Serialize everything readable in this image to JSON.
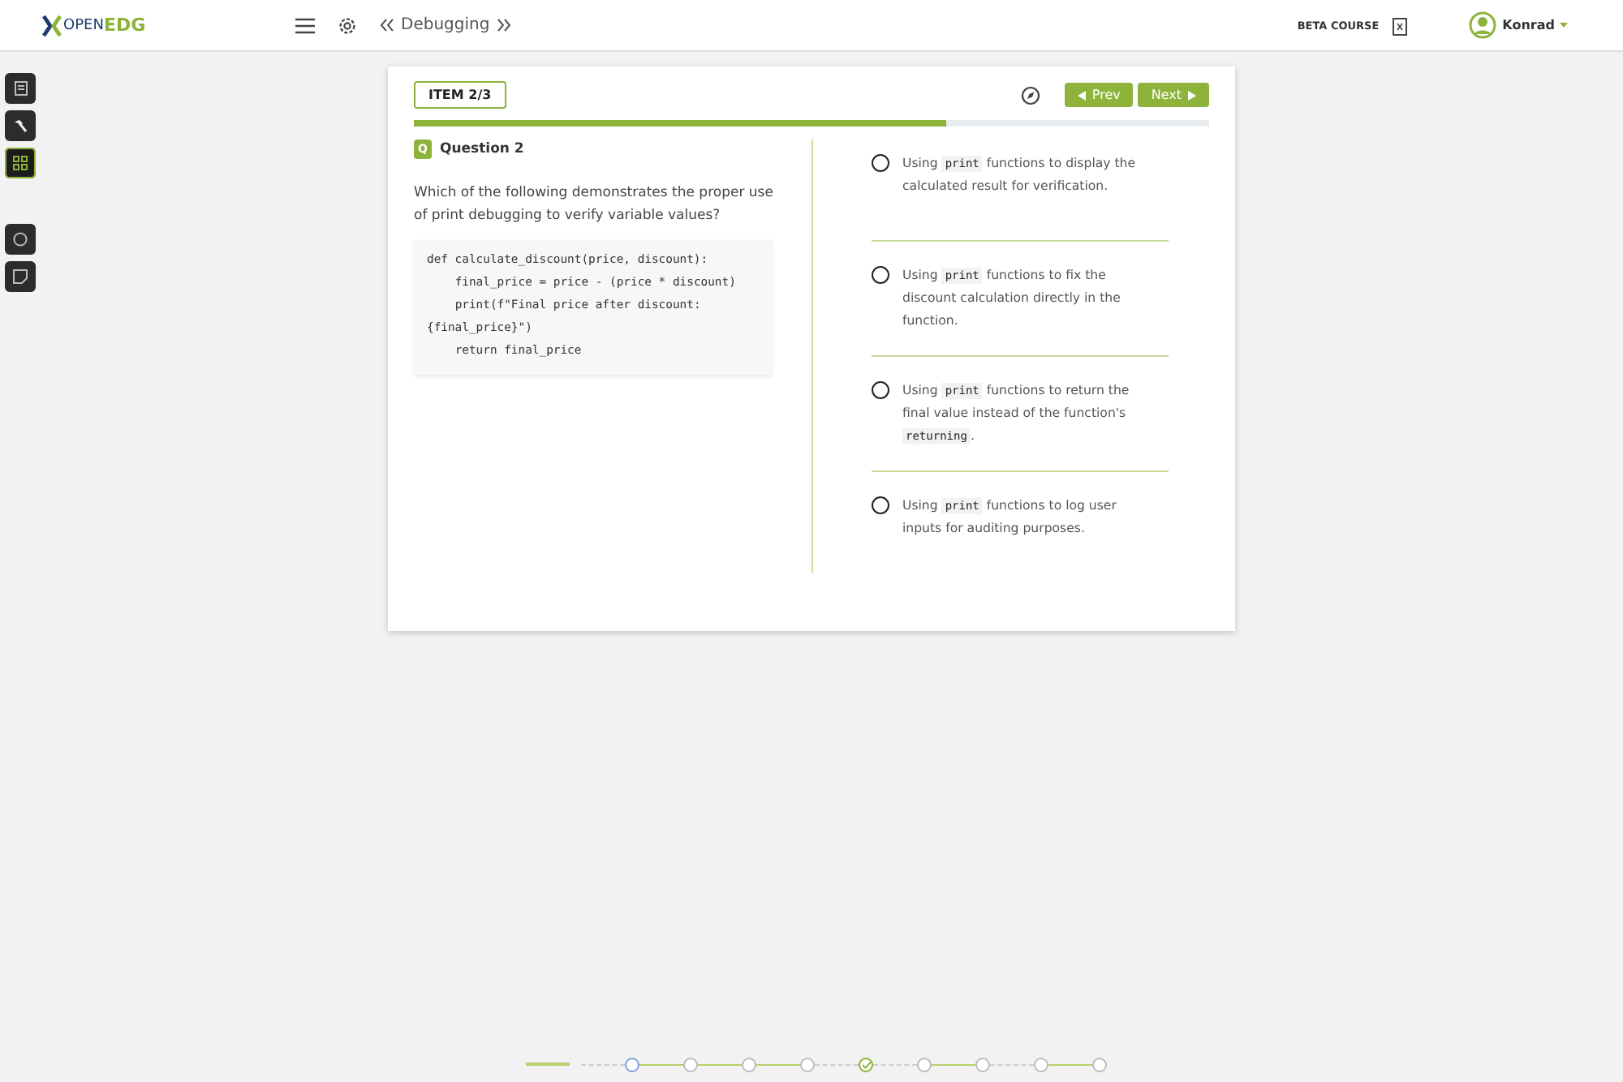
{
  "header": {
    "logo_prefix": "OPEN",
    "logo_suffix": "EDG",
    "breadcrumb": "Debugging",
    "course_label": "BETA COURSE",
    "user": "Konrad"
  },
  "sidebar_tools": [
    {
      "kind": "page",
      "selected": false
    },
    {
      "kind": "hammer",
      "selected": false
    },
    {
      "kind": "grid",
      "selected": true
    },
    {
      "kind": "chat",
      "selected": false
    },
    {
      "kind": "note",
      "selected": false
    }
  ],
  "item": {
    "label": "ITEM 2/3",
    "prev": "Prev",
    "next": "Next",
    "level": 0.67
  },
  "question": {
    "badge": "Q",
    "title": "Question 2",
    "prompt": "Which of the following demonstrates the proper use of print debugging to verify variable values?",
    "code": "def calculate_discount(price, discount):\n    final_price = price - (price * discount)\n    print(f\"Final price after discount: {final_price}\")\n    return final_price"
  },
  "options": [
    {
      "selected": false,
      "parts": [
        {
          "kind": "text",
          "text": "Using "
        },
        {
          "kind": "code",
          "text": "print"
        },
        {
          "kind": "text",
          "text": " functions to display the calculated result for verification."
        }
      ]
    },
    {
      "selected": false,
      "parts": [
        {
          "kind": "text",
          "text": "Using "
        },
        {
          "kind": "code",
          "text": "print"
        },
        {
          "kind": "text",
          "text": " functions to fix the discount calculation directly in the function."
        }
      ]
    },
    {
      "selected": false,
      "parts": [
        {
          "kind": "text",
          "text": "Using "
        },
        {
          "kind": "code",
          "text": "print"
        },
        {
          "kind": "text",
          "text": " functions to return the final value instead of the function's "
        },
        {
          "kind": "code",
          "text": "returning"
        },
        {
          "kind": "text",
          "text": "."
        }
      ]
    },
    {
      "selected": false,
      "parts": [
        {
          "kind": "text",
          "text": "Using "
        },
        {
          "kind": "code",
          "text": "print"
        },
        {
          "kind": "text",
          "text": " functions to log user inputs for auditing purposes."
        }
      ]
    }
  ],
  "stepper": [
    {
      "dashed": true,
      "current": true,
      "done": false
    },
    {
      "dashed": false,
      "current": false,
      "done": false
    },
    {
      "dashed": false,
      "current": false,
      "done": false
    },
    {
      "dashed": false,
      "current": false,
      "done": false
    },
    {
      "dashed": true,
      "current": false,
      "done": true
    },
    {
      "dashed": true,
      "current": false,
      "done": false
    },
    {
      "dashed": false,
      "current": false,
      "done": false
    },
    {
      "dashed": true,
      "current": false,
      "done": false
    },
    {
      "dashed": false,
      "current": false,
      "done": false
    }
  ]
}
